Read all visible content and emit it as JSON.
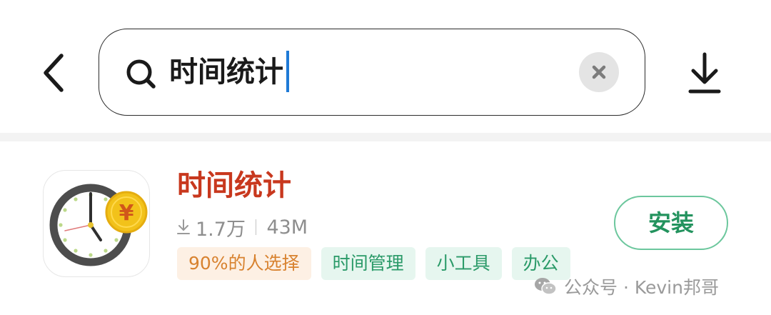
{
  "search": {
    "query": "时间统计"
  },
  "result": {
    "app_name": "时间统计",
    "downloads": "1.7万",
    "size": "43M",
    "tags": [
      {
        "label": "90%的人选择",
        "kind": "hot"
      },
      {
        "label": "时间管理",
        "kind": "category"
      },
      {
        "label": "小工具",
        "kind": "category"
      },
      {
        "label": "办公",
        "kind": "category"
      }
    ],
    "install_label": "安装",
    "icon": "clock-with-yen-coin-icon"
  },
  "watermark": {
    "text": "公众号 · Kevin邦哥",
    "icon": "wechat-icon"
  },
  "colors": {
    "app_title": "#c8381e",
    "install_border": "#6cc79d",
    "install_text": "#23935e",
    "hot_tag_bg": "#fdf0e4",
    "hot_tag_text": "#d8822f",
    "category_tag_bg": "#e6f6ef",
    "category_tag_text": "#2a9a68",
    "caret": "#1f7ad6",
    "coin": "#f2c21a"
  }
}
